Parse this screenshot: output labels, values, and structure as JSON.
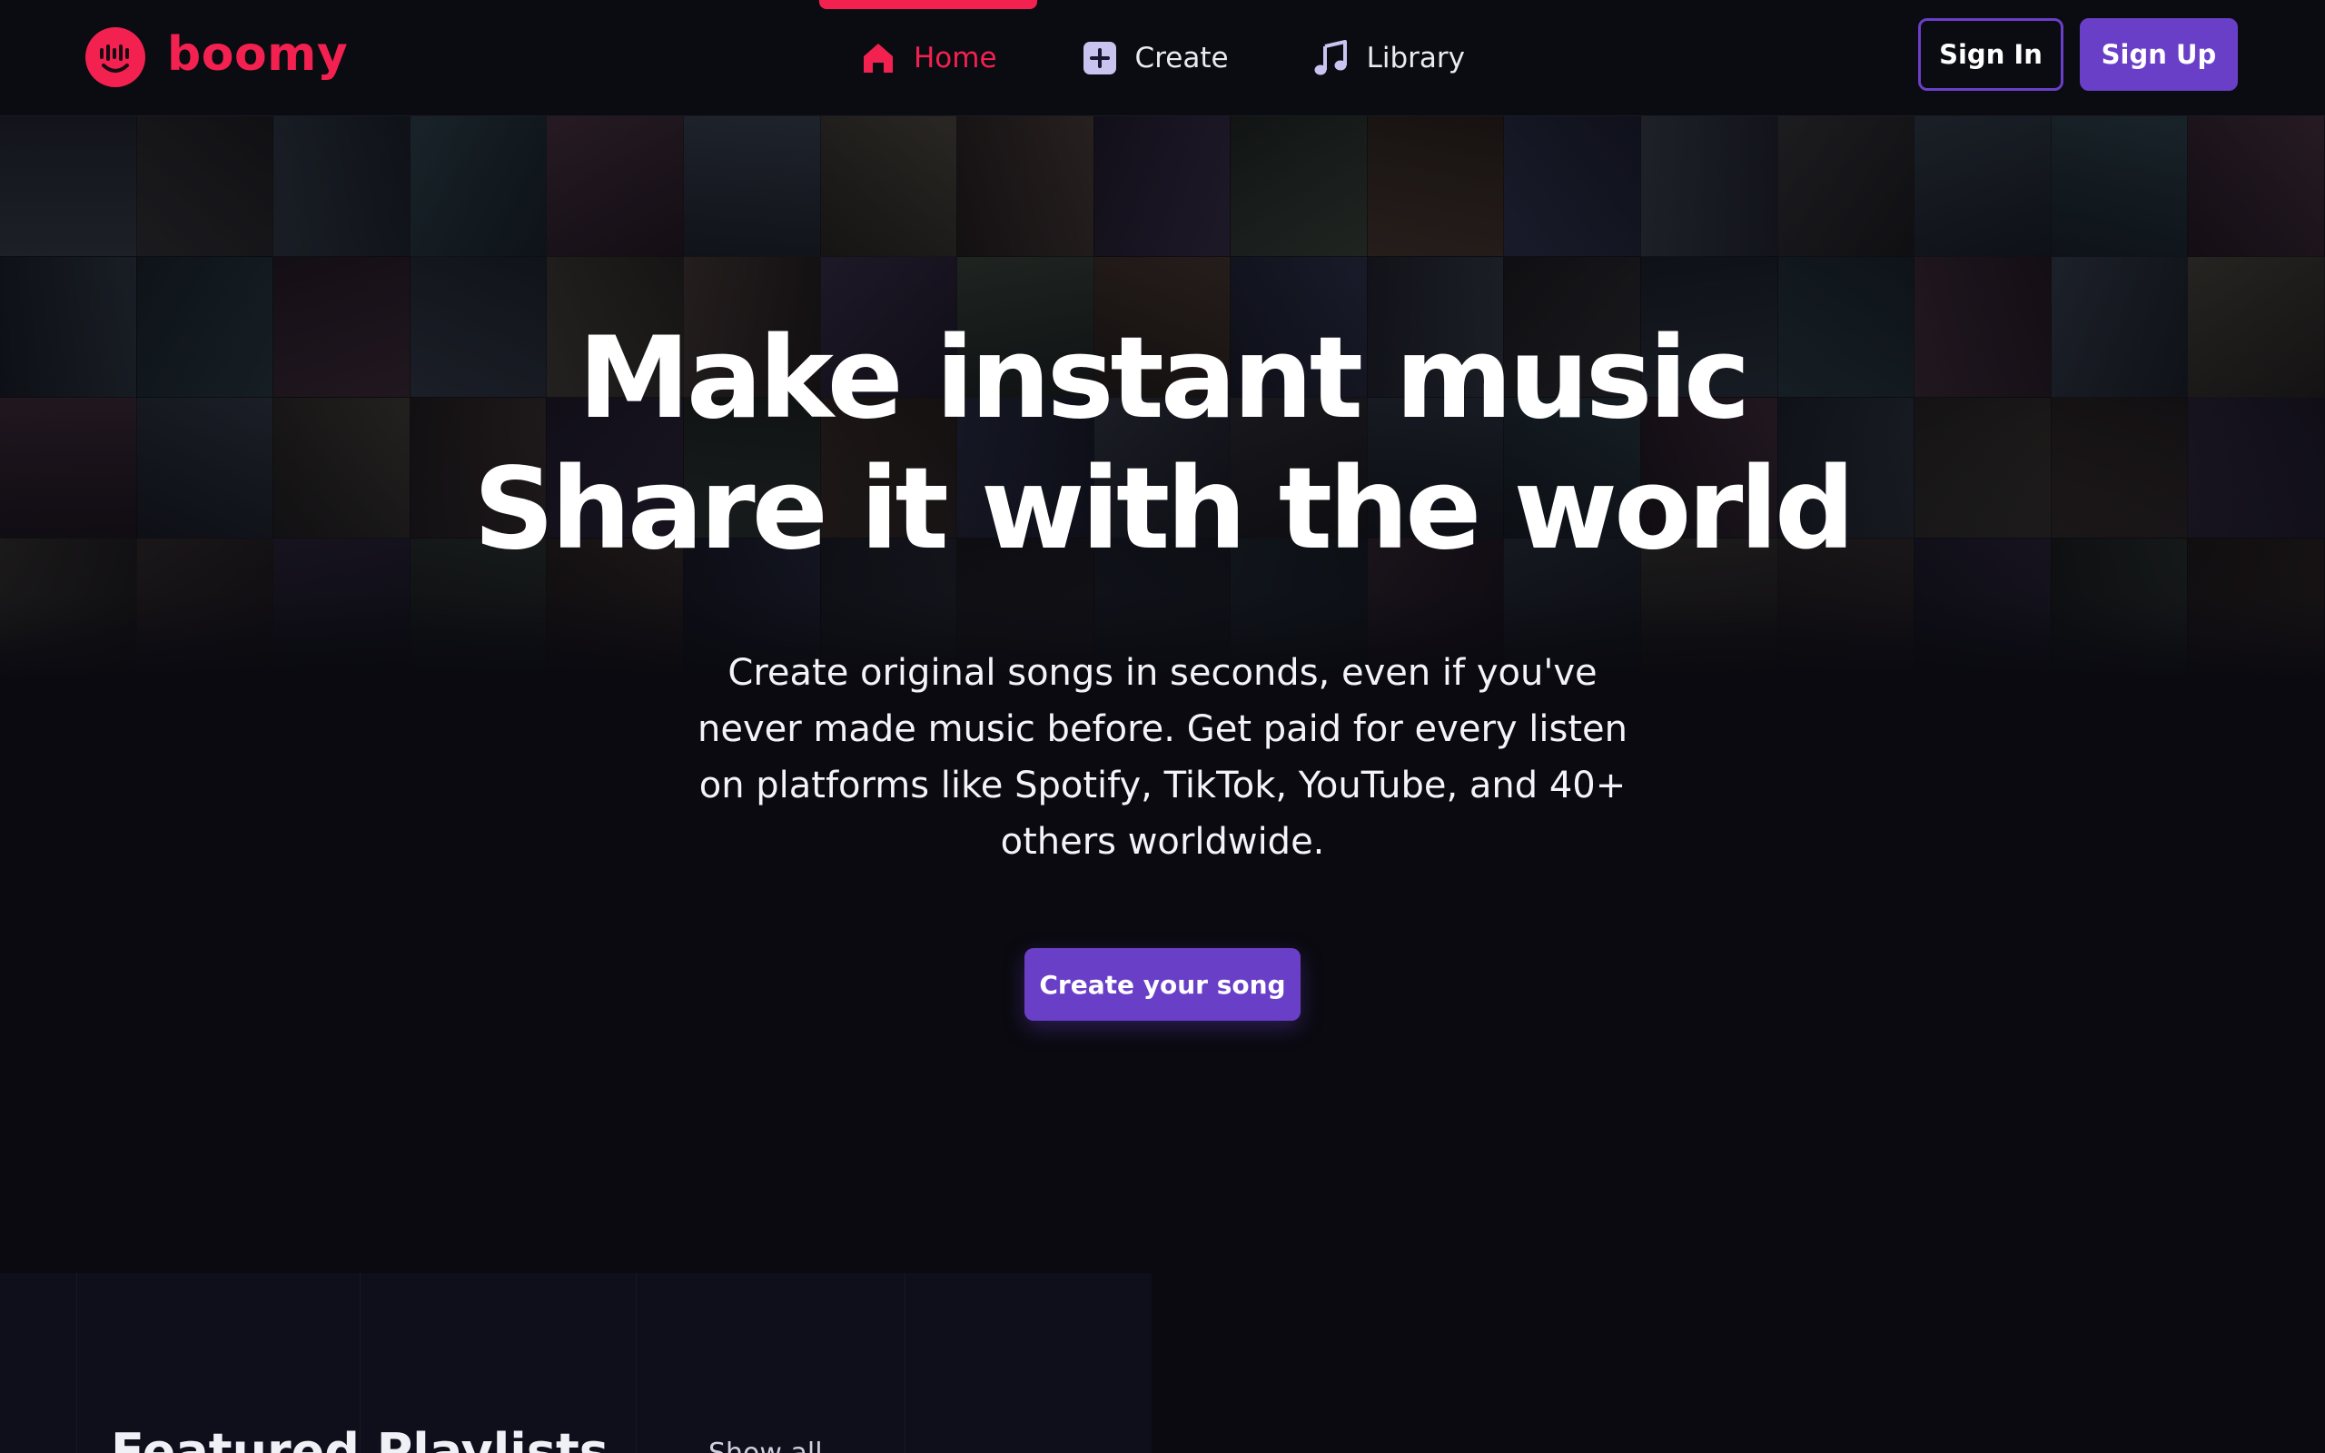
{
  "brand": {
    "name": "boomy",
    "color": "#f2214f",
    "logo_icon": "boomy-smiley-icon"
  },
  "nav": {
    "items": [
      {
        "label": "Home",
        "icon": "home-icon",
        "active": true
      },
      {
        "label": "Create",
        "icon": "plus-square-icon",
        "active": false
      },
      {
        "label": "Library",
        "icon": "music-note-icon",
        "active": false
      }
    ]
  },
  "auth": {
    "sign_in": "Sign In",
    "sign_up": "Sign Up"
  },
  "hero": {
    "headline_line1": "Make instant music",
    "headline_line2": "Share it with the world",
    "subtext": "Create original songs in seconds, even if you've never made music before. Get paid for every listen on platforms like Spotify, TikTok, YouTube, and 40+ others worldwide.",
    "cta": "Create your song"
  },
  "featured": {
    "title": "Featured Playlists",
    "link": "Show all"
  },
  "colors": {
    "accent": "#f2214f",
    "primary_button": "#6a3fc8",
    "background": "#0a0a10",
    "header": "#0b0b12"
  }
}
